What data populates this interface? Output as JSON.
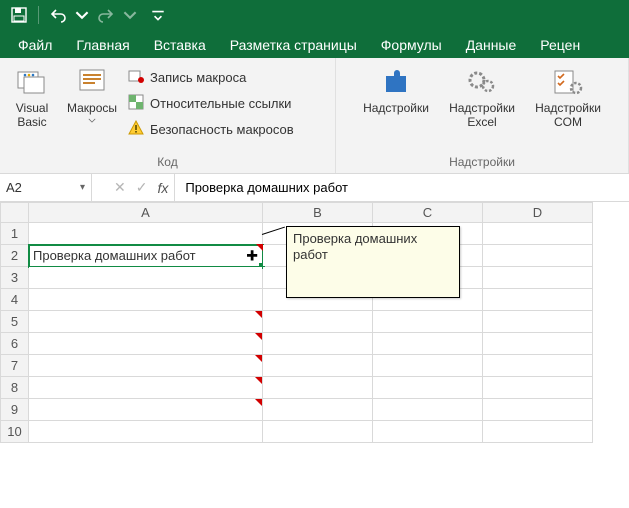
{
  "titlebar": {},
  "tabs": {
    "file": "Файл",
    "home": "Главная",
    "insert": "Вставка",
    "layout": "Разметка страницы",
    "formulas": "Формулы",
    "data": "Данные",
    "review": "Рецен"
  },
  "ribbon": {
    "code": {
      "label": "Код",
      "visual_basic": "Visual Basic",
      "macros": "Макросы",
      "record_macro": "Запись макроса",
      "relative_refs": "Относительные ссылки",
      "macro_security": "Безопасность макросов"
    },
    "addins": {
      "label": "Надстройки",
      "addins": "Надстройки",
      "excel_addins": "Надстройки Excel",
      "com_addins": "Надстройки COM"
    }
  },
  "formula_bar": {
    "name_box": "A2",
    "formula_value": "Проверка домашних работ"
  },
  "grid": {
    "columns": [
      "A",
      "B",
      "C",
      "D"
    ],
    "rows": [
      "1",
      "2",
      "3",
      "4",
      "5",
      "6",
      "7",
      "8",
      "9",
      "10"
    ],
    "cells": {
      "A2": "Проверка домашних работ"
    },
    "comment": "Проверка домашних работ"
  }
}
